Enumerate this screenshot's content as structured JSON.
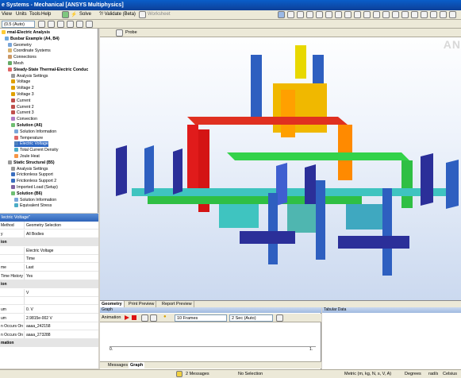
{
  "window": {
    "title": "e Systems - Mechanical [ANSYS Multiphysics]"
  },
  "menu": [
    "View",
    "Units",
    "Tools",
    "Help"
  ],
  "toolbar": {
    "solve_label": "Solve",
    "validate_label": "?/ Validate (Beta)",
    "worksheet_label": "Worksheet"
  },
  "toolbar2": {
    "combo1": "(0.5 (Auto)",
    "probe_label": "Probe"
  },
  "tree": {
    "items": [
      {
        "label": "rmal-Electric Analysis",
        "bold": true
      },
      {
        "label": "Busbar Example (A4, B4)",
        "bold": true
      },
      {
        "label": "Geometry"
      },
      {
        "label": "Coordinate Systems"
      },
      {
        "label": "Connections"
      },
      {
        "label": "Mesh"
      },
      {
        "label": "Steady-State Thermal-Electric Conduc",
        "bold": true
      },
      {
        "label": "Analysis Settings"
      },
      {
        "label": "Voltage"
      },
      {
        "label": "Voltage 2"
      },
      {
        "label": "Voltage 3"
      },
      {
        "label": "Current"
      },
      {
        "label": "Current 2"
      },
      {
        "label": "Current 3"
      },
      {
        "label": "Convection"
      },
      {
        "label": "Solution (A6)",
        "bold": true
      },
      {
        "label": "Solution Information"
      },
      {
        "label": "Temperature"
      },
      {
        "label": "Electric Voltage",
        "selected": true
      },
      {
        "label": "Total Current Density"
      },
      {
        "label": "Joule Heat"
      },
      {
        "label": "Static Structural (B5)",
        "bold": true
      },
      {
        "label": "Analysis Settings"
      },
      {
        "label": "Frictionless Support"
      },
      {
        "label": "Frictionless Support 2"
      },
      {
        "label": "Imported Load (Setup)"
      },
      {
        "label": "Solution (B6)",
        "bold": true
      },
      {
        "label": "Solution Information"
      },
      {
        "label": "Equivalent Stress"
      }
    ]
  },
  "details": {
    "header": "lectric Voltage\"",
    "rows": [
      {
        "k": "Method",
        "v": "Geometry Selection"
      },
      {
        "k": "y",
        "v": "All Bodies"
      },
      {
        "k": "ion",
        "v": "",
        "section": true
      },
      {
        "k": "",
        "v": "Electric Voltage"
      },
      {
        "k": "",
        "v": "Time"
      },
      {
        "k": "me",
        "v": "Last"
      },
      {
        "k": "Time History",
        "v": "Yes"
      },
      {
        "k": "ion",
        "v": "",
        "section": true
      },
      {
        "k": "",
        "v": "V"
      },
      {
        "k": "",
        "v": "",
        "section": false
      },
      {
        "k": "um",
        "v": "0. V"
      },
      {
        "k": "um",
        "v": "2.9815e-002 V"
      },
      {
        "k": "n Occurs On",
        "v": "aaaa_242158"
      },
      {
        "k": "n Occurs On",
        "v": "aaaa_273288"
      },
      {
        "k": "mation",
        "v": "",
        "section": true
      }
    ]
  },
  "viewport": {
    "logo": "AN"
  },
  "view_tabs": [
    "Geometry",
    "Print Preview",
    "Report Preview"
  ],
  "graph": {
    "header": "Graph",
    "animation_label": "Animation",
    "frames": "10 Frames",
    "duration": "2 Sec (Auto)",
    "tick_start": "0.",
    "tick_end": "1.",
    "tabs": [
      "Messages",
      "Graph"
    ]
  },
  "tabular": {
    "header": "Tabular Data"
  },
  "status": {
    "messages": "2 Messages",
    "selection": "No Selection",
    "units": "Metric (m, kg, N, s, V, A)",
    "angle": "Degrees",
    "rate": "rad/s",
    "temp": "Celsius"
  },
  "colors": {
    "red": "#e01b1b",
    "orange": "#ffa000",
    "yellow": "#e8d800",
    "green": "#33d24a",
    "cyan": "#3fc4c0",
    "blue": "#2e5fc0",
    "navy": "#2b2f99"
  }
}
